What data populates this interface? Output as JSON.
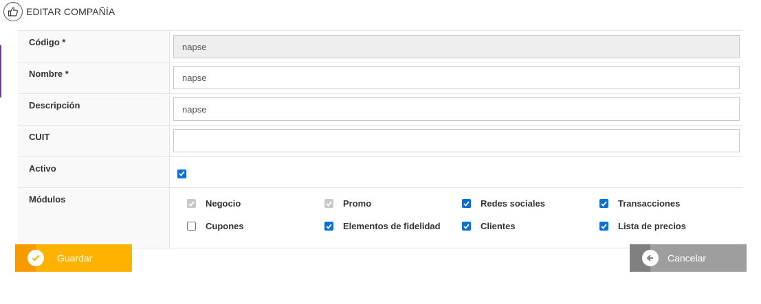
{
  "header": {
    "title": "EDITAR COMPAÑÍA",
    "icon": "thumbs-up-icon"
  },
  "form": {
    "codigo": {
      "label": "Código *",
      "value": "napse"
    },
    "nombre": {
      "label": "Nombre *",
      "value": "napse"
    },
    "descripcion": {
      "label": "Descripción",
      "value": "napse"
    },
    "cuit": {
      "label": "CUIT",
      "value": ""
    },
    "activo": {
      "label": "Activo",
      "checked": true
    },
    "modulos": {
      "label": "Módulos",
      "items": [
        {
          "label": "Negocio",
          "state": "checked-disabled"
        },
        {
          "label": "Promo",
          "state": "checked-disabled"
        },
        {
          "label": "Redes sociales",
          "state": "checked"
        },
        {
          "label": "Transacciones",
          "state": "checked"
        },
        {
          "label": "Cupones",
          "state": "unchecked"
        },
        {
          "label": "Elementos de fidelidad",
          "state": "checked"
        },
        {
          "label": "Clientes",
          "state": "checked"
        },
        {
          "label": "Lista de precios",
          "state": "checked"
        }
      ]
    }
  },
  "actions": {
    "save_label": "Guardar",
    "cancel_label": "Cancelar"
  },
  "colors": {
    "save": "#ffb300",
    "save_dark": "#f79a00",
    "cancel": "#9e9e9e",
    "cancel_dark": "#808080",
    "checkbox": "#0b6fd4",
    "accent": "#6a3d8f"
  }
}
